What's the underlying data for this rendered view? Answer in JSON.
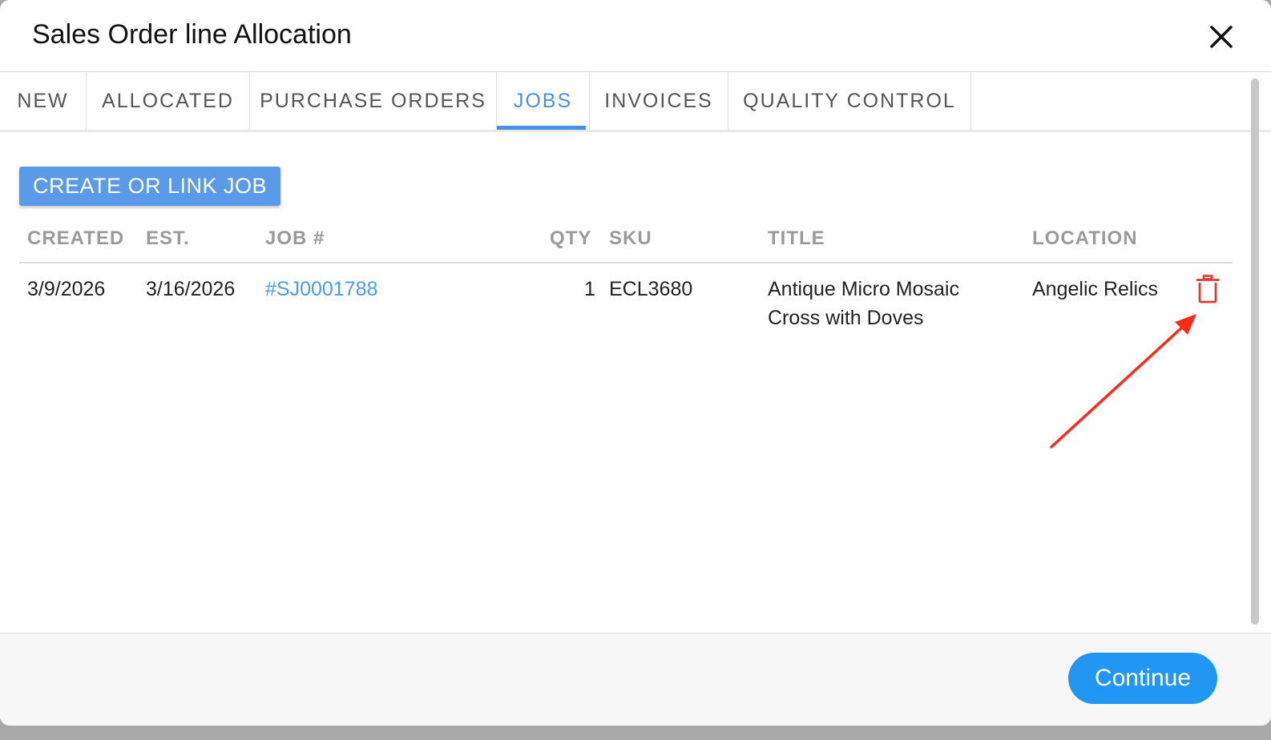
{
  "modal": {
    "title": "Sales Order line Allocation",
    "close_icon": "close-icon"
  },
  "tabs": [
    {
      "label": "NEW"
    },
    {
      "label": "ALLOCATED"
    },
    {
      "label": "PURCHASE ORDERS"
    },
    {
      "label": "JOBS",
      "active": true
    },
    {
      "label": "INVOICES"
    },
    {
      "label": "QUALITY CONTROL"
    }
  ],
  "actions": {
    "create_label": "CREATE OR LINK JOB"
  },
  "table": {
    "columns": [
      "CREATED",
      "EST.",
      "JOB #",
      "QTY",
      "SKU",
      "TITLE",
      "LOCATION"
    ],
    "rows": [
      {
        "created": "3/9/2026",
        "est": "3/16/2026",
        "job": "#SJ0001788",
        "qty": "1",
        "sku": "ECL3680",
        "title_line1": "Antique Micro Mosaic",
        "title_line2": "Cross with Doves",
        "location": "Angelic Relics",
        "delete_icon": "trash-icon"
      }
    ]
  },
  "footer": {
    "continue_label": "Continue"
  },
  "colors": {
    "accent": "#4a90e2",
    "primary_button": "#2196f3",
    "delete": "#e53935",
    "annotation_arrow": "#ff2a1a"
  }
}
